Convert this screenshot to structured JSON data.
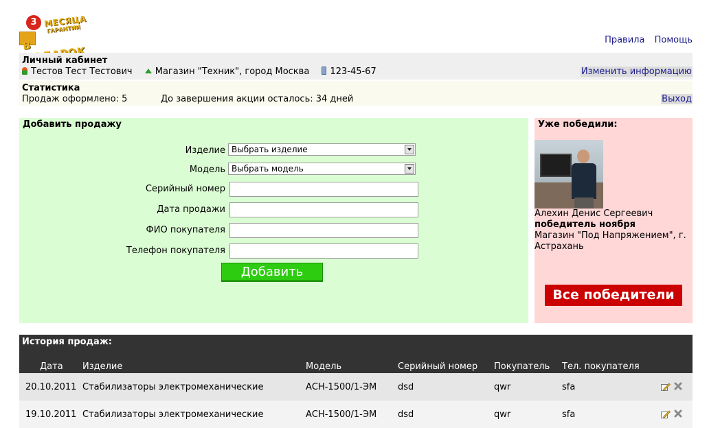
{
  "logo": {
    "badge": "3",
    "line1": "МЕСЯЦА",
    "line2": "ГАРАНТИИ",
    "line3": "В ПОДАРОК"
  },
  "toplinks": {
    "rules": "Правила",
    "help": "Помощь"
  },
  "cabinet": {
    "title": "Личный кабинет",
    "user": "Тестов Тест Тестович",
    "shop": "Магазин \"Техник\", город Москва",
    "phone": "123-45-67",
    "edit": "Изменить информацию"
  },
  "stats": {
    "title": "Статистика",
    "sold": "Продаж оформлено: 5",
    "left": "До завершения акции осталось: 34 дней",
    "exit": "Выход"
  },
  "add_sale": {
    "title": "Добавить продажу",
    "product_label": "Изделие",
    "product_value": "Выбрать изделие",
    "model_label": "Модель",
    "model_value": "Выбрать модель",
    "serial_label": "Серийный номер",
    "date_label": "Дата продажи",
    "buyer_label": "ФИО покупателя",
    "buyer_phone_label": "Телефон покупателя",
    "submit": "Добавить"
  },
  "winners": {
    "title": "Уже победили:",
    "name": "Алехин Денис Сергеевич",
    "role": "победитель ноября",
    "shop": "Магазин \"Под Напряжением\", г. Астрахань",
    "all": "Все победители"
  },
  "history": {
    "title": "История продаж:",
    "columns": {
      "date": "Дата",
      "item": "Изделие",
      "model": "Модель",
      "serial": "Серийный номер",
      "buyer": "Покупатель",
      "phone": "Тел. покупателя"
    },
    "rows": [
      {
        "date": "20.10.2011",
        "item": "Стабилизаторы электромеханические",
        "model": "АСН-1500/1-ЭМ",
        "serial": "dsd",
        "buyer": "qwr",
        "phone": "sfa"
      },
      {
        "date": "19.10.2011",
        "item": "Стабилизаторы электромеханические",
        "model": "АСН-1500/1-ЭМ",
        "serial": "dsd",
        "buyer": "qwr",
        "phone": "sfa"
      }
    ]
  },
  "colors": {
    "add_sale_bg": "#dbfdd3",
    "winners_bg": "#ffd7d7",
    "history_header_bg": "#333333",
    "submit_bg": "#2ecc10",
    "all_winners_bg": "#cc0000"
  }
}
